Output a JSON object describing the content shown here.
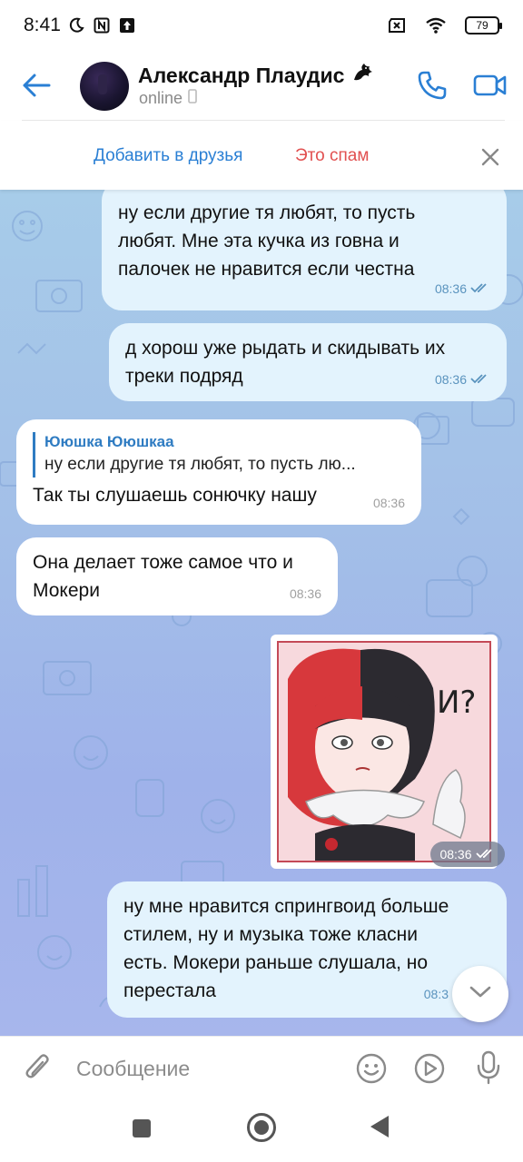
{
  "status_bar": {
    "time": "8:41",
    "battery": "79"
  },
  "header": {
    "contact_name": "Александр Плаудис",
    "contact_status": "online"
  },
  "action_bar": {
    "add_friend_label": "Добавить в друзья",
    "spam_label": "Это спам"
  },
  "messages": [
    {
      "direction": "outgoing",
      "text_lines": [
        "ну если другие тя любят, то пусть",
        "любят. Мне эта кучка из говна и",
        "палочек не нравится если честна"
      ],
      "time": "08:36",
      "read": true
    },
    {
      "direction": "outgoing",
      "text_lines": [
        "д хорош уже рыдать и скидывать их",
        "треки подряд"
      ],
      "time": "08:36",
      "read": true
    },
    {
      "direction": "incoming",
      "reply_author": "Ююшка Ююшкаа",
      "reply_text": "ну если другие тя любят, то пусть лю...",
      "text_lines": [
        "Так ты слушаешь сонючку нашу"
      ],
      "time": "08:36"
    },
    {
      "direction": "incoming",
      "text_lines": [
        "Она делает тоже самое что и",
        "Мокери"
      ],
      "time": "08:36"
    },
    {
      "direction": "outgoing",
      "type": "sticker",
      "sticker_caption": "И?",
      "time": "08:36",
      "read": true
    },
    {
      "direction": "outgoing",
      "text_lines": [
        "ну мне нравится спрингвоид больше",
        "стилем, ну и музыка тоже класни",
        "есть. Мокери раньше слушала, но",
        "перестала"
      ],
      "time": "08:3"
    }
  ],
  "input": {
    "placeholder": "Сообщение"
  },
  "colors": {
    "accent": "#2a7fd4",
    "spam": "#e15050",
    "outgoing_bubble": "#e3f3fd",
    "incoming_bubble": "#ffffff",
    "chat_bg": "#a3bfe8"
  },
  "icons": {
    "back": "arrow-left-icon",
    "call": "phone-icon",
    "video": "video-camera-icon",
    "close": "close-icon",
    "attach": "paperclip-icon",
    "emoji": "smiley-icon",
    "sticker_panel": "play-circle-icon",
    "voice": "microphone-icon",
    "scroll": "chevron-down-icon"
  }
}
